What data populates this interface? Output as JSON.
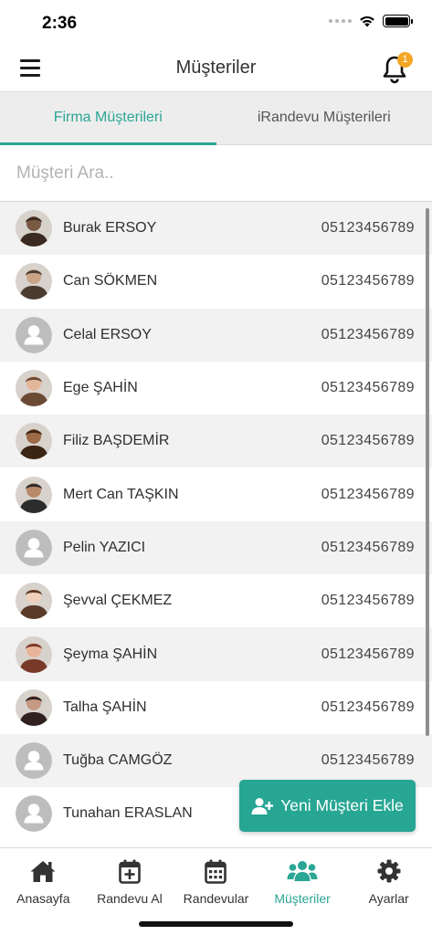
{
  "status_bar": {
    "time": "2:36"
  },
  "header": {
    "title": "Müşteriler",
    "notification_count": "1"
  },
  "tabs": [
    {
      "label": "Firma Müşterileri",
      "active": true
    },
    {
      "label": "iRandevu Müşterileri",
      "active": false
    }
  ],
  "search": {
    "placeholder": "Müşteri Ara..",
    "value": ""
  },
  "customers": [
    {
      "name": "Burak ERSOY",
      "phone": "05123456789",
      "avatar": "photo"
    },
    {
      "name": "Can SÖKMEN",
      "phone": "05123456789",
      "avatar": "photo"
    },
    {
      "name": "Celal ERSOY",
      "phone": "05123456789",
      "avatar": "placeholder"
    },
    {
      "name": "Ege ŞAHİN",
      "phone": "05123456789",
      "avatar": "photo"
    },
    {
      "name": "Filiz BAŞDEMİR",
      "phone": "05123456789",
      "avatar": "photo"
    },
    {
      "name": "Mert Can TAŞKIN",
      "phone": "05123456789",
      "avatar": "photo"
    },
    {
      "name": "Pelin YAZICI",
      "phone": "05123456789",
      "avatar": "placeholder"
    },
    {
      "name": "Şevval ÇEKMEZ",
      "phone": "05123456789",
      "avatar": "photo"
    },
    {
      "name": "Şeyma ŞAHİN",
      "phone": "05123456789",
      "avatar": "photo"
    },
    {
      "name": "Talha ŞAHİN",
      "phone": "05123456789",
      "avatar": "photo"
    },
    {
      "name": "Tuğba CAMGÖZ",
      "phone": "05123456789",
      "avatar": "placeholder"
    },
    {
      "name": "Tunahan ERASLAN",
      "phone": "",
      "avatar": "placeholder"
    }
  ],
  "fab": {
    "label": "Yeni Müşteri Ekle",
    "icon": "user-plus-icon"
  },
  "bottom_nav": [
    {
      "label": "Anasayfa",
      "icon": "home-icon",
      "active": false
    },
    {
      "label": "Randevu Al",
      "icon": "calendar-plus-icon",
      "active": false
    },
    {
      "label": "Randevular",
      "icon": "calendar-icon",
      "active": false
    },
    {
      "label": "Müşteriler",
      "icon": "users-icon",
      "active": true
    },
    {
      "label": "Ayarlar",
      "icon": "gear-icon",
      "active": false
    }
  ],
  "colors": {
    "accent": "#2aa695",
    "badge": "#f5a623",
    "row_alt": "#f2f2f2"
  }
}
